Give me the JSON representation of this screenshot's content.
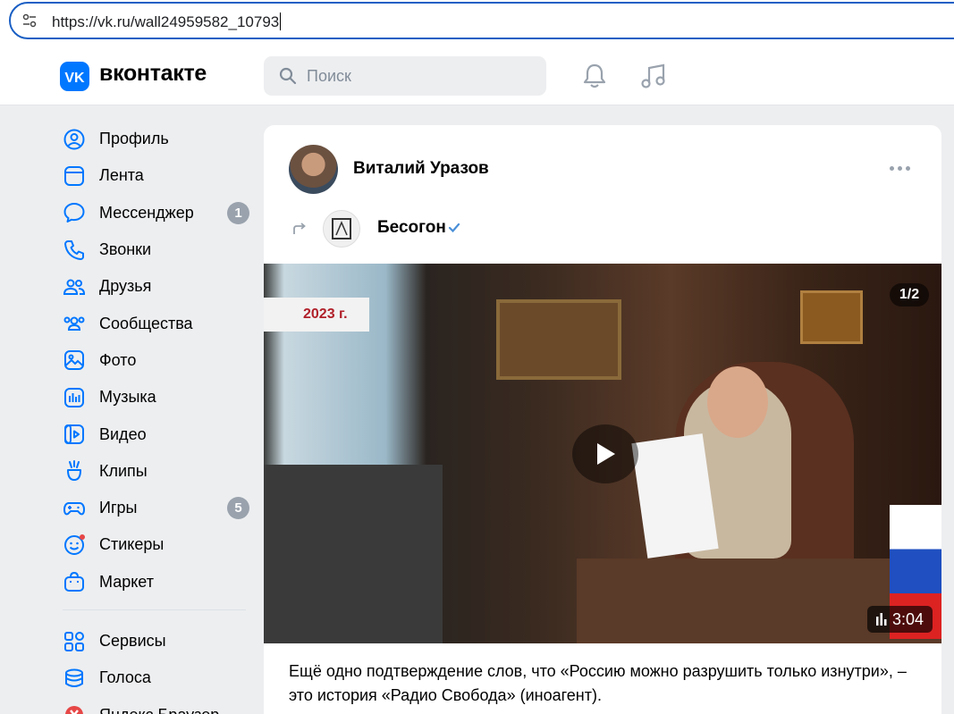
{
  "browser": {
    "url": "https://vk.ru/wall24959582_10793"
  },
  "header": {
    "logo_text": "вконтакте",
    "search_placeholder": "Поиск",
    "accent_color": "#0077ff"
  },
  "sidebar": {
    "items": [
      {
        "label": "Профиль",
        "icon": "profile-icon"
      },
      {
        "label": "Лента",
        "icon": "feed-icon"
      },
      {
        "label": "Мессенджер",
        "icon": "messenger-icon",
        "badge": "1"
      },
      {
        "label": "Звонки",
        "icon": "calls-icon"
      },
      {
        "label": "Друзья",
        "icon": "friends-icon"
      },
      {
        "label": "Сообщества",
        "icon": "communities-icon"
      },
      {
        "label": "Фото",
        "icon": "photo-icon"
      },
      {
        "label": "Музыка",
        "icon": "music-icon"
      },
      {
        "label": "Видео",
        "icon": "video-icon"
      },
      {
        "label": "Клипы",
        "icon": "clips-icon"
      },
      {
        "label": "Игры",
        "icon": "games-icon",
        "badge": "5"
      },
      {
        "label": "Стикеры",
        "icon": "stickers-icon"
      },
      {
        "label": "Маркет",
        "icon": "market-icon"
      }
    ],
    "extra_items": [
      {
        "label": "Сервисы",
        "icon": "services-icon"
      },
      {
        "label": "Голоса",
        "icon": "votes-icon"
      },
      {
        "label": "Яндекс Браузер",
        "icon": "yandex-browser-icon"
      }
    ]
  },
  "post": {
    "author": "Виталий Уразов",
    "repost_from": "Бесогон",
    "media": {
      "overlay_year": "2023 г.",
      "counter": "1/2",
      "duration": "3:04"
    },
    "text": "Ещё одно подтверждение слов, что «Россию можно разрушить только изнутри», – это история «Радио Свобода» (иноагент)."
  }
}
